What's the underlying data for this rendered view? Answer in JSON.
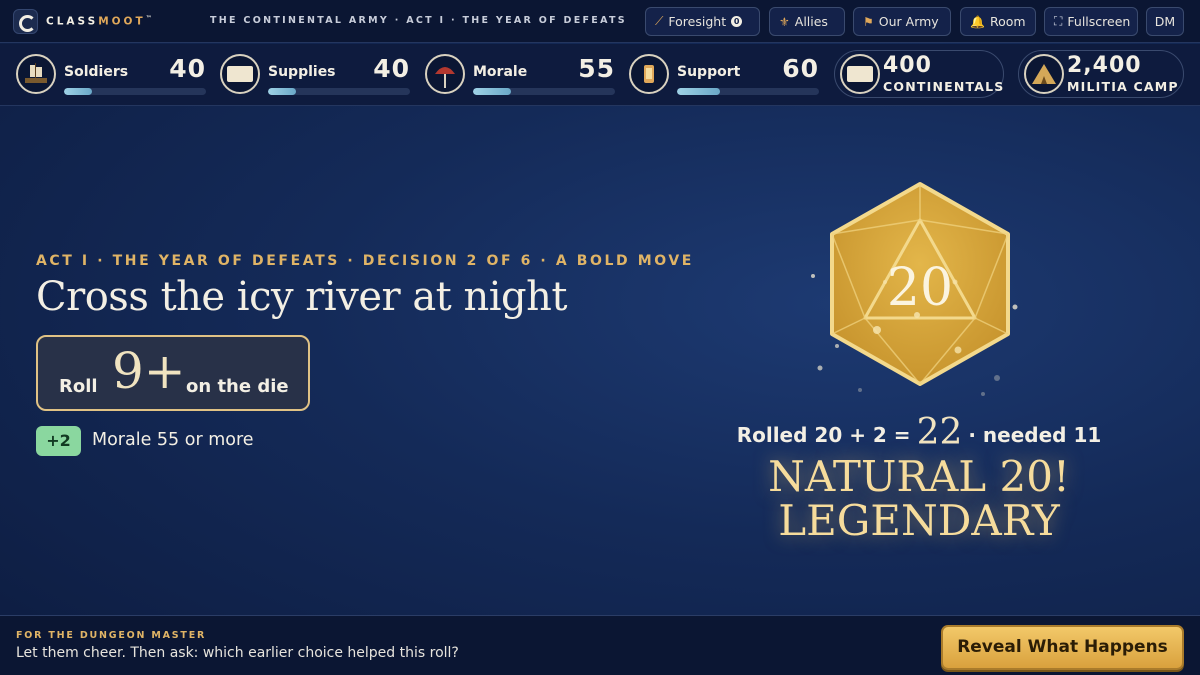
{
  "app": {
    "brand_part1": "CLASS",
    "brand_part2": "MOOT",
    "trademark": "™"
  },
  "breadcrumb": "THE CONTINENTAL ARMY · ACT I · THE YEAR OF DEFEATS",
  "toolbar": {
    "foresight_label": "Foresight",
    "foresight_count": "0",
    "allies_label": "Allies",
    "army_label": "Our Army",
    "room_label": "Room",
    "fullscreen_label": "Fullscreen",
    "dm_label": "DM"
  },
  "stats": [
    {
      "label": "Soldiers",
      "value": "40",
      "fill_percent": 20
    },
    {
      "label": "Supplies",
      "value": "40",
      "fill_percent": 20
    },
    {
      "label": "Morale",
      "value": "55",
      "fill_percent": 27
    },
    {
      "label": "Support",
      "value": "60",
      "fill_percent": 30
    }
  ],
  "forces": [
    {
      "number": "400",
      "label": "CONTINENTALS"
    },
    {
      "number": "2,400",
      "label": "MILITIA CAMP"
    }
  ],
  "decision": {
    "eyebrow": "ACT I · THE YEAR OF DEFEATS · DECISION 2 OF 6 · A BOLD MOVE",
    "title": "Cross the icy river at night",
    "roll_pre": "Roll",
    "roll_target": "9+",
    "roll_post": "on the die",
    "modifier": "+2",
    "modifier_text": "Morale 55 or more"
  },
  "die": {
    "face_value": "20"
  },
  "result": {
    "pre": "Rolled 20 + 2 =",
    "total": "22",
    "post": "· needed 11",
    "line1": "NATURAL 20!",
    "line2": "LEGENDARY"
  },
  "footer": {
    "label": "FOR THE DUNGEON MASTER",
    "text": "Let them cheer. Then ask: which earlier choice helped this roll?",
    "button_label": "Reveal What Happens"
  },
  "colors": {
    "accent_gold": "#e0b466",
    "die_gold": "#d4a43a",
    "background": "#142a58",
    "modifier_green": "#8ad79f"
  }
}
